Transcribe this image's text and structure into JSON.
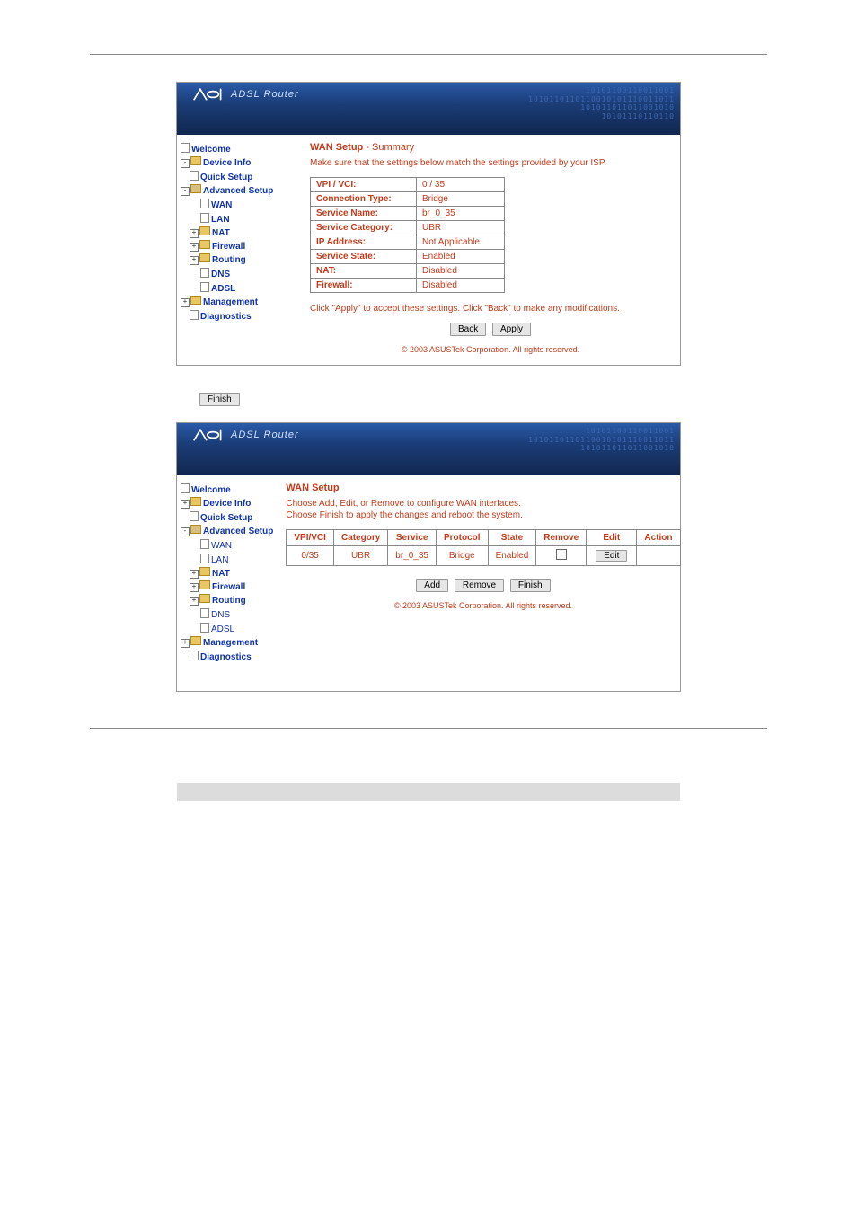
{
  "brand": {
    "name": "ASUS",
    "product": "ADSL Router"
  },
  "panel1": {
    "sidebar": {
      "welcome": "Welcome",
      "device_info": "Device Info",
      "quick_setup": "Quick Setup",
      "advanced_setup": "Advanced Setup",
      "wan": "WAN",
      "lan": "LAN",
      "nat": "NAT",
      "firewall": "Firewall",
      "routing": "Routing",
      "dns": "DNS",
      "adsl": "ADSL",
      "management": "Management",
      "diagnostics": "Diagnostics"
    },
    "title_main": "WAN Setup",
    "title_sub": " - Summary",
    "help1": "Make sure that the settings below match the settings provided by your ISP.",
    "rows": {
      "r1k": "VPI / VCI:",
      "r1v": "0 / 35",
      "r2k": "Connection Type:",
      "r2v": "Bridge",
      "r3k": "Service Name:",
      "r3v": "br_0_35",
      "r4k": "Service Category:",
      "r4v": "UBR",
      "r5k": "IP Address:",
      "r5v": "Not Applicable",
      "r6k": "Service State:",
      "r6v": "Enabled",
      "r7k": "NAT:",
      "r7v": "Disabled",
      "r8k": "Firewall:",
      "r8v": "Disabled"
    },
    "apply_note": "Click \"Apply\" to accept these settings. Click \"Back\" to make any modifications.",
    "back_btn": "Back",
    "apply_btn": "Apply",
    "copyright": "© 2003 ASUSTek Corporation. All rights reserved."
  },
  "between": {
    "finish_btn": "Finish"
  },
  "panel2": {
    "sidebar": {
      "welcome": "Welcome",
      "device_info": "Device Info",
      "quick_setup": "Quick Setup",
      "advanced_setup": "Advanced Setup",
      "wan": "WAN",
      "lan": "LAN",
      "nat": "NAT",
      "firewall": "Firewall",
      "routing": "Routing",
      "dns": "DNS",
      "adsl": "ADSL",
      "management": "Management",
      "diagnostics": "Diagnostics"
    },
    "title_main": "WAN Setup",
    "help1": "Choose Add, Edit, or Remove to configure WAN interfaces.",
    "help2": "Choose Finish to apply the changes and reboot the system.",
    "table": {
      "h1": "VPI/VCI",
      "h2": "Category",
      "h3": "Service",
      "h4": "Protocol",
      "h5": "State",
      "h6": "Remove",
      "h7": "Edit",
      "h8": "Action",
      "c1": "0/35",
      "c2": "UBR",
      "c3": "br_0_35",
      "c4": "Bridge",
      "c5": "Enabled",
      "c7": "Edit"
    },
    "add_btn": "Add",
    "remove_btn": "Remove",
    "finish_btn": "Finish",
    "copyright": "© 2003 ASUSTek Corporation. All rights reserved."
  }
}
